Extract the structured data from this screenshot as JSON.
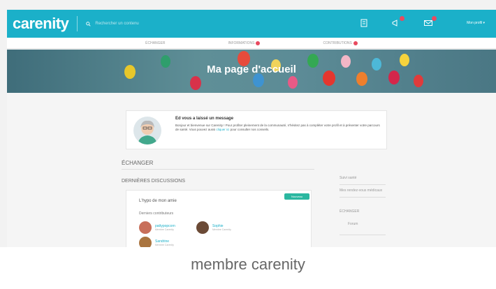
{
  "app": {
    "logo": "carenity",
    "logo_sub": ""
  },
  "search": {
    "placeholder": "Rechercher un contenu"
  },
  "header": {
    "user_menu": "Mon profil ▾"
  },
  "colors": {
    "brand": "#1bb0c9",
    "badge": "#e84a5f",
    "tag": "#2bb7a0"
  },
  "icons": [
    "search-icon",
    "document-icon",
    "megaphone-icon",
    "mail-icon"
  ],
  "subnav": [
    {
      "label": "ÉCHANGER"
    },
    {
      "label": "INFORMATIONS"
    },
    {
      "label": "CONTRIBUTIONS"
    }
  ],
  "banner": {
    "title": "Ma page d'accueil"
  },
  "intro": {
    "title": "Ed vous a laissé un message",
    "body_1": "Bonjour et bienvenue sur Carenity ! Pour profiter pleinement de la communauté, n'hésitez pas à compléter votre profil et à présenter votre parcours de santé. Vous pouvez aussi ",
    "link": "cliquer ici",
    "body_2": " pour consulter nos conseils."
  },
  "sections": {
    "exchange": "ÉCHANGER",
    "discussions": "DERNIÈRES DISCUSSIONS"
  },
  "discussion": {
    "tag": "Nouveau",
    "heading": "L'hypo de mon amie",
    "sub": "Derniers contributeurs",
    "members": [
      {
        "name": "pattypopcorn",
        "meta": "Membre Carenity"
      },
      {
        "name": "Sophie",
        "meta": "Membre Carenity"
      },
      {
        "name": "Sandrine",
        "meta": "Membre Carenity"
      }
    ]
  },
  "sidebar": {
    "label_1": "Suivi santé",
    "label_2": "Mes rendez-vous médicaux",
    "label_3": "ÉCHANGER",
    "label_4": "Forum"
  },
  "caption": "membre carenity"
}
